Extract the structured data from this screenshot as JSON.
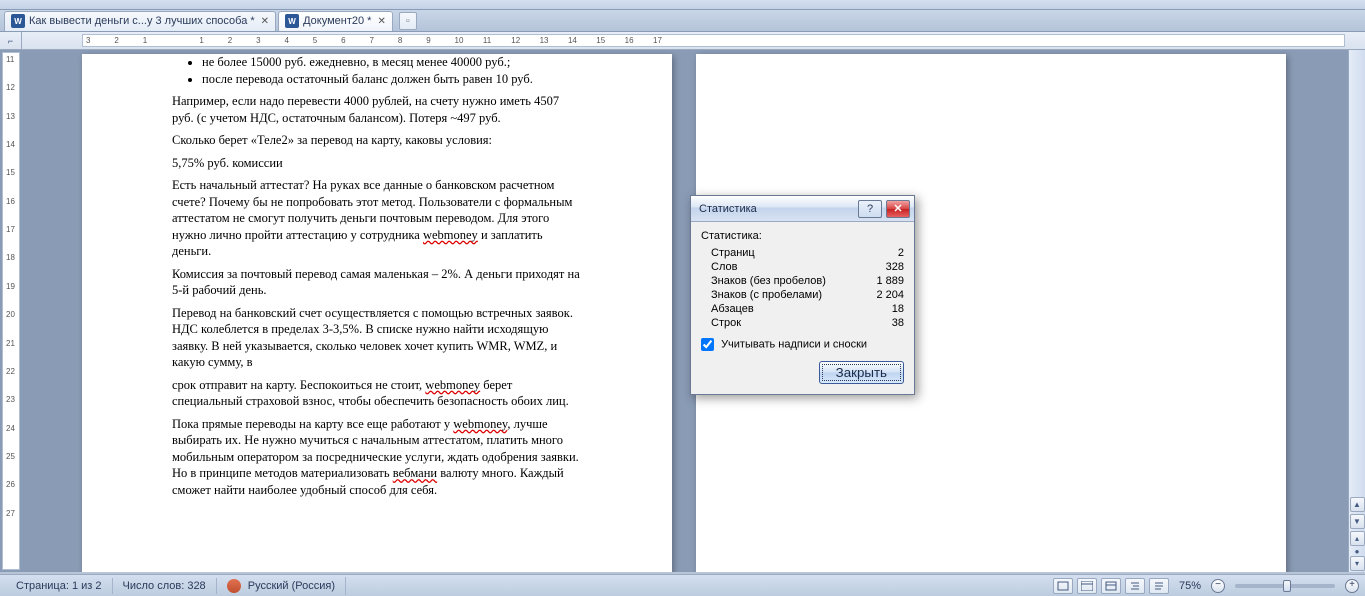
{
  "tabs": [
    {
      "label": "Как вывести деньги с...у 3 лучших способа *",
      "active": false
    },
    {
      "label": "Документ20 *",
      "active": true
    }
  ],
  "ruler": {
    "h": [
      "3",
      "2",
      "1",
      "",
      "1",
      "2",
      "3",
      "4",
      "5",
      "6",
      "7",
      "8",
      "9",
      "10",
      "11",
      "12",
      "13",
      "14",
      "15",
      "16",
      "17"
    ],
    "v": [
      "11",
      "12",
      "13",
      "14",
      "15",
      "16",
      "17",
      "18",
      "19",
      "20",
      "21",
      "22",
      "23",
      "24",
      "25",
      "26",
      "27"
    ]
  },
  "document": {
    "bullets": [
      "не более 15000 руб. ежедневно, в месяц менее 40000 руб.;",
      "после перевода остаточный баланс должен быть равен 10 руб."
    ],
    "paragraphs": [
      "Например, если надо перевести 4000 рублей, на счету нужно иметь 4507 руб. (с учетом НДС, остаточным балансом). Потеря ~497 руб.",
      "Сколько берет «Теле2» за перевод на карту, каковы условия:",
      "5,75% руб. комиссии",
      "Есть начальный аттестат? На руках все данные о банковском расчетном счете? Почему бы не попробовать этот метод. Пользователи с формальным аттестатом не смогут получить деньги почтовым переводом. Для этого нужно лично пройти аттестацию у сотрудника webmoney и заплатить деньги.",
      "Комиссия за почтовый перевод самая маленькая – 2%. А деньги приходят на 5-й рабочий день.",
      "Перевод на банковский счет осуществляется с помощью встречных заявок. НДС колеблется в пределах 3-3,5%. В списке нужно найти исходящую заявку. В ней указывается, сколько человек хочет купить WMR, WMZ,  и какую сумму, в",
      "срок отправит на карту. Беспокоиться не стоит, webmoney берет специальный страховой взнос, чтобы обеспечить безопасность обоих лиц.",
      "Пока прямые переводы на карту все еще работают у webmoney, лучше выбирать их. Не нужно мучиться с начальным аттестатом, платить много мобильным оператором за посреднические услуги, ждать одобрения заявки. Но в принципе методов материализовать вебмани валюту много. Каждый сможет найти наиболее удобный способ для себя."
    ]
  },
  "dialog": {
    "title": "Статистика",
    "heading": "Статистика:",
    "rows": [
      {
        "label": "Страниц",
        "value": "2"
      },
      {
        "label": "Слов",
        "value": "328"
      },
      {
        "label": "Знаков (без пробелов)",
        "value": "1 889"
      },
      {
        "label": "Знаков (с пробелами)",
        "value": "2 204"
      },
      {
        "label": "Абзацев",
        "value": "18"
      },
      {
        "label": "Строк",
        "value": "38"
      }
    ],
    "checkbox_label": "Учитывать надписи и сноски",
    "checkbox_checked": true,
    "close_btn": "Закрыть"
  },
  "status": {
    "page": "Страница: 1 из 2",
    "words": "Число слов: 328",
    "language": "Русский (Россия)",
    "zoom": "75%"
  }
}
